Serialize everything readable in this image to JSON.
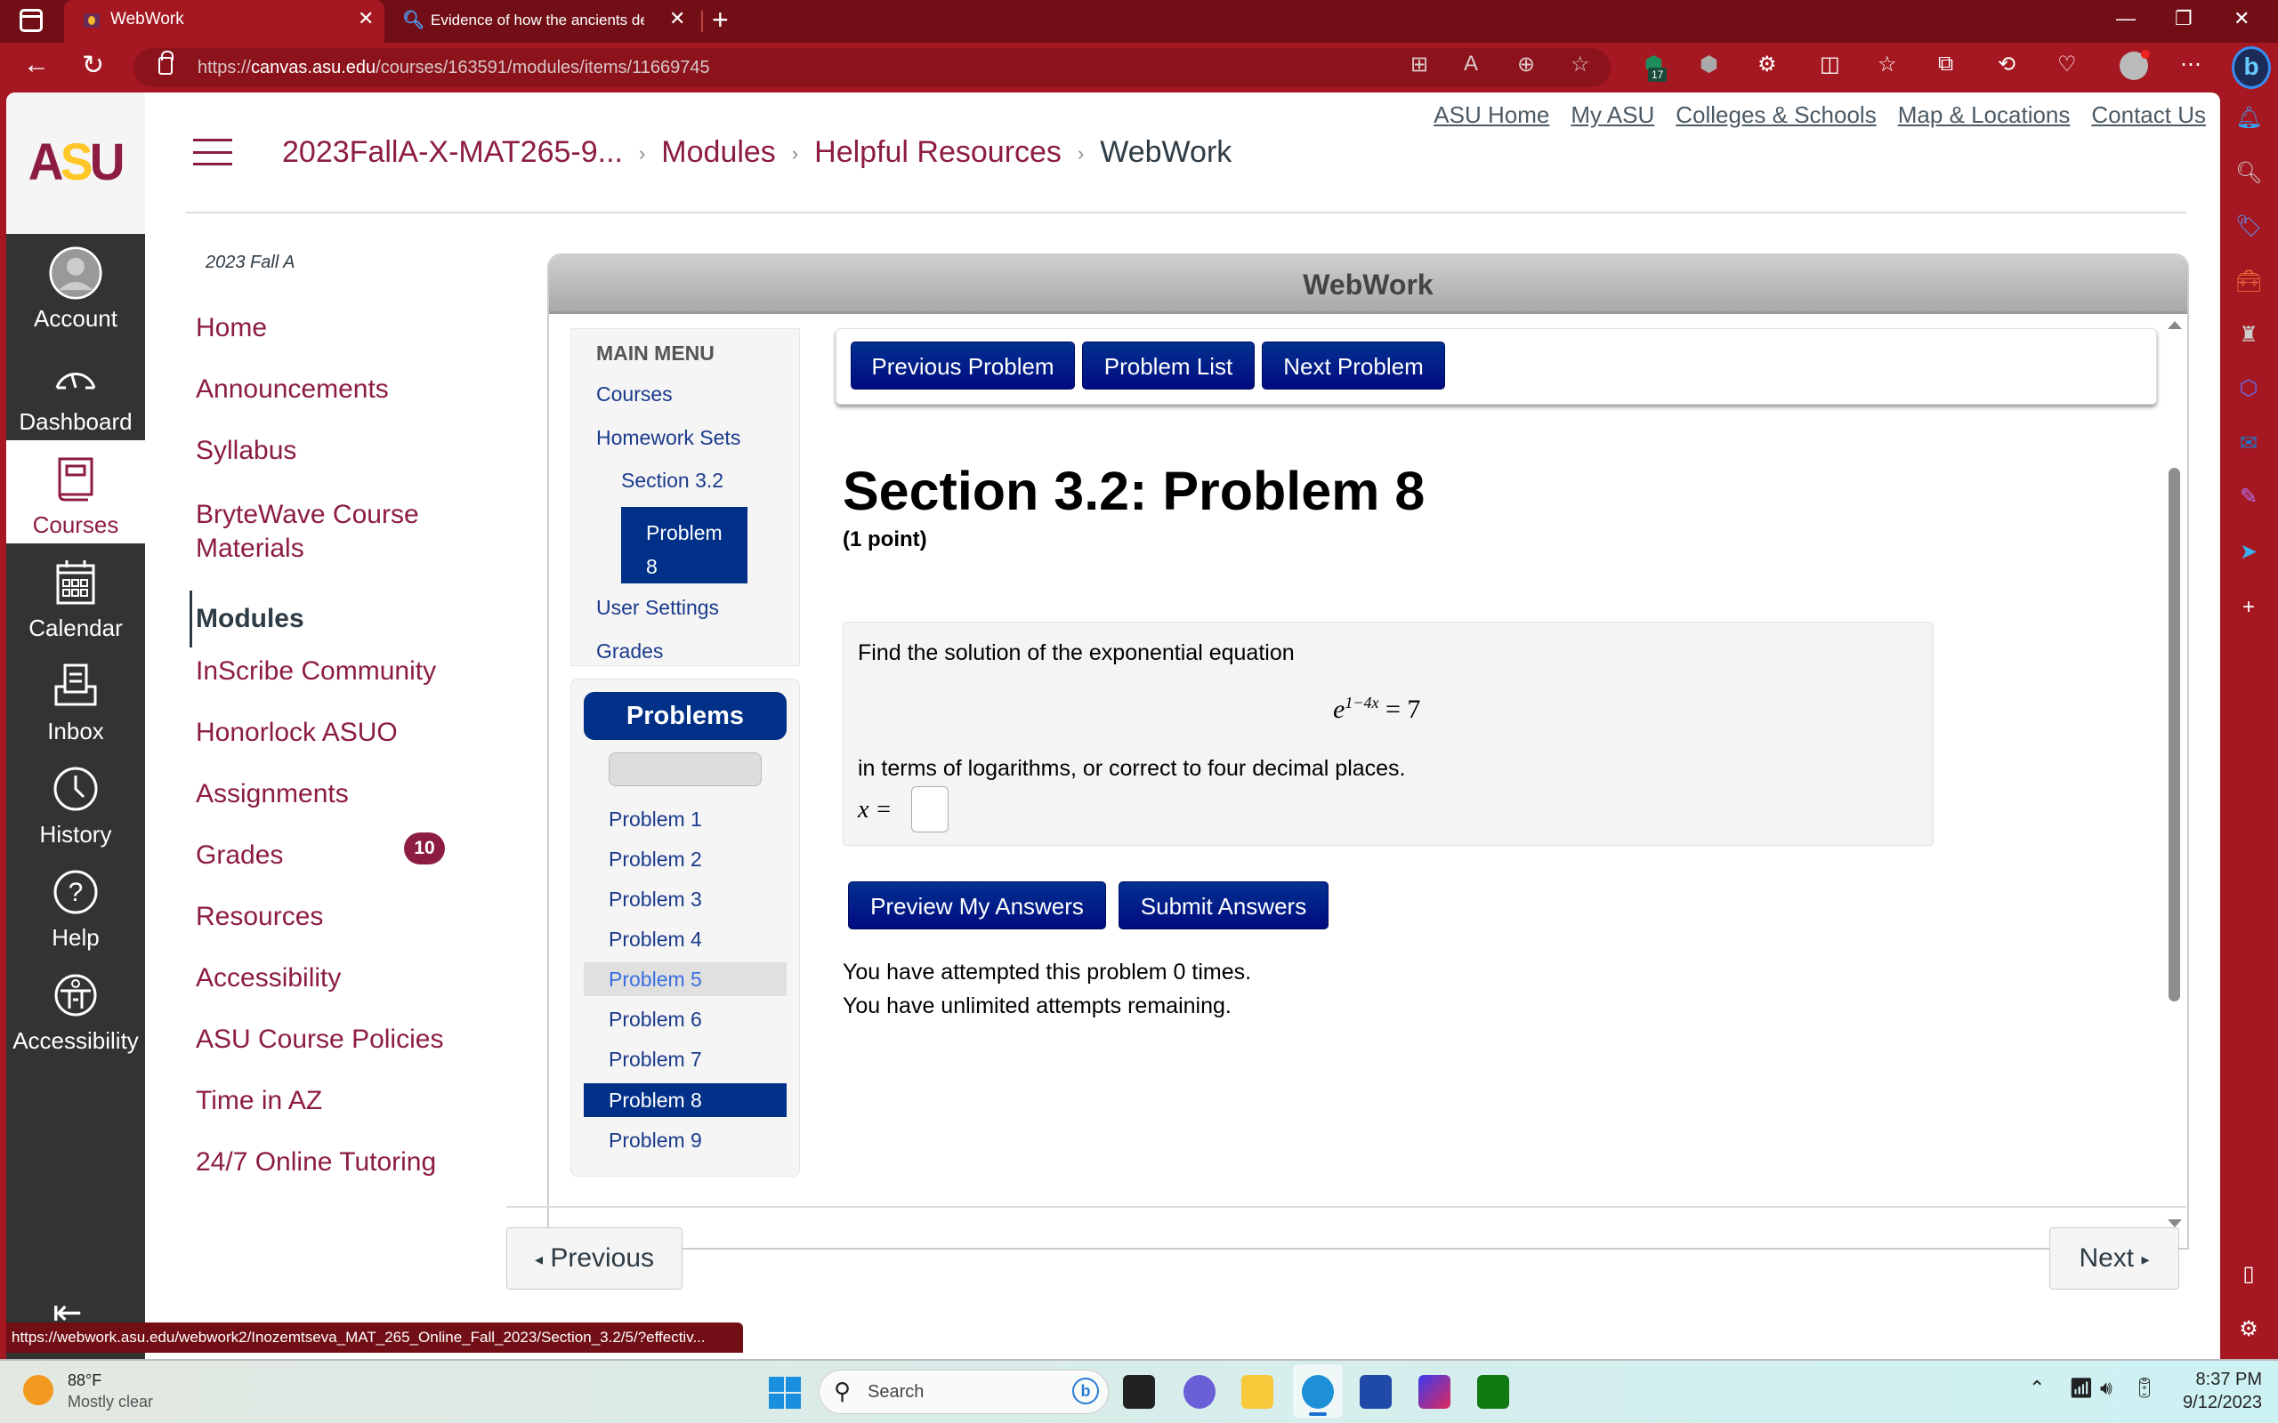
{
  "browser": {
    "tabs": [
      {
        "title": "WebWork",
        "active": true
      },
      {
        "title": "Evidence of how the ancients des",
        "active": false
      }
    ],
    "url_prefix": "https://",
    "url_host": "canvas.asu.edu",
    "url_path": "/courses/163591/modules/items/11669745",
    "extension_badge": "17",
    "status_url": "https://webwork.asu.edu/webwork2/Inozemtseva_MAT_265_Online_Fall_2023/Section_3.2/5/?effectiv..."
  },
  "canvas": {
    "logo": {
      "a": "A",
      "s": "S",
      "u": "U"
    },
    "global_nav": [
      {
        "label": "Account",
        "icon": "avatar-icon"
      },
      {
        "label": "Dashboard",
        "icon": "dashboard-icon"
      },
      {
        "label": "Courses",
        "icon": "book-icon",
        "active": true
      },
      {
        "label": "Calendar",
        "icon": "calendar-icon"
      },
      {
        "label": "Inbox",
        "icon": "inbox-icon"
      },
      {
        "label": "History",
        "icon": "clock-icon"
      },
      {
        "label": "Help",
        "icon": "help-icon"
      },
      {
        "label": "Accessibility",
        "icon": "accessibility-icon"
      }
    ],
    "breadcrumb": [
      "2023FallA-X-MAT265-9...",
      "Modules",
      "Helpful Resources",
      "WebWork"
    ],
    "top_links": [
      "ASU Home",
      "My ASU",
      "Colleges & Schools",
      "Map & Locations",
      "Contact Us"
    ],
    "term": "2023 Fall A",
    "course_nav": [
      {
        "label": "Home"
      },
      {
        "label": "Announcements"
      },
      {
        "label": "Syllabus"
      },
      {
        "label": "BryteWave Course Materials"
      },
      {
        "label": "Modules",
        "active": true
      },
      {
        "label": "InScribe Community"
      },
      {
        "label": "Honorlock ASUO"
      },
      {
        "label": "Assignments"
      },
      {
        "label": "Grades",
        "badge": "10"
      },
      {
        "label": "Resources"
      },
      {
        "label": "Accessibility"
      },
      {
        "label": "ASU Course Policies"
      },
      {
        "label": "Time in AZ"
      },
      {
        "label": "24/7 Online Tutoring"
      }
    ],
    "pager": {
      "previous": "Previous",
      "next": "Next"
    }
  },
  "webwork": {
    "title": "WebWork",
    "main_menu": {
      "heading": "MAIN MENU",
      "items": [
        "Courses",
        "Homework Sets",
        "Section 3.2",
        "User Settings",
        "Grades"
      ],
      "current_problem_line1": "Problem",
      "current_problem_line2": "8"
    },
    "problems_heading": "Problems",
    "problem_list": [
      "Problem 1",
      "Problem 2",
      "Problem 3",
      "Problem 4",
      "Problem 5",
      "Problem 6",
      "Problem 7",
      "Problem 8",
      "Problem 9"
    ],
    "hovered_problem": "Problem 5",
    "current_problem": "Problem 8",
    "nav_buttons": [
      "Previous Problem",
      "Problem List",
      "Next Problem"
    ],
    "problem_title": "Section 3.2: Problem 8",
    "points": "(1 point)",
    "text1": "Find the solution of the exponential equation",
    "equation_base": "e",
    "equation_exponent": "1−4x",
    "equation_rhs": "= 7",
    "text2": "in terms of logarithms, or correct to four decimal places.",
    "answer_label": "x =",
    "answer_value": "",
    "preview_button": "Preview My Answers",
    "submit_button": "Submit Answers",
    "attempts_line1": "You have attempted this problem 0 times.",
    "attempts_line2": "You have unlimited attempts remaining."
  },
  "taskbar": {
    "weather_temp": "88°F",
    "weather_condition": "Mostly clear",
    "search_placeholder": "Search",
    "time": "8:37 PM",
    "date": "9/12/2023"
  }
}
